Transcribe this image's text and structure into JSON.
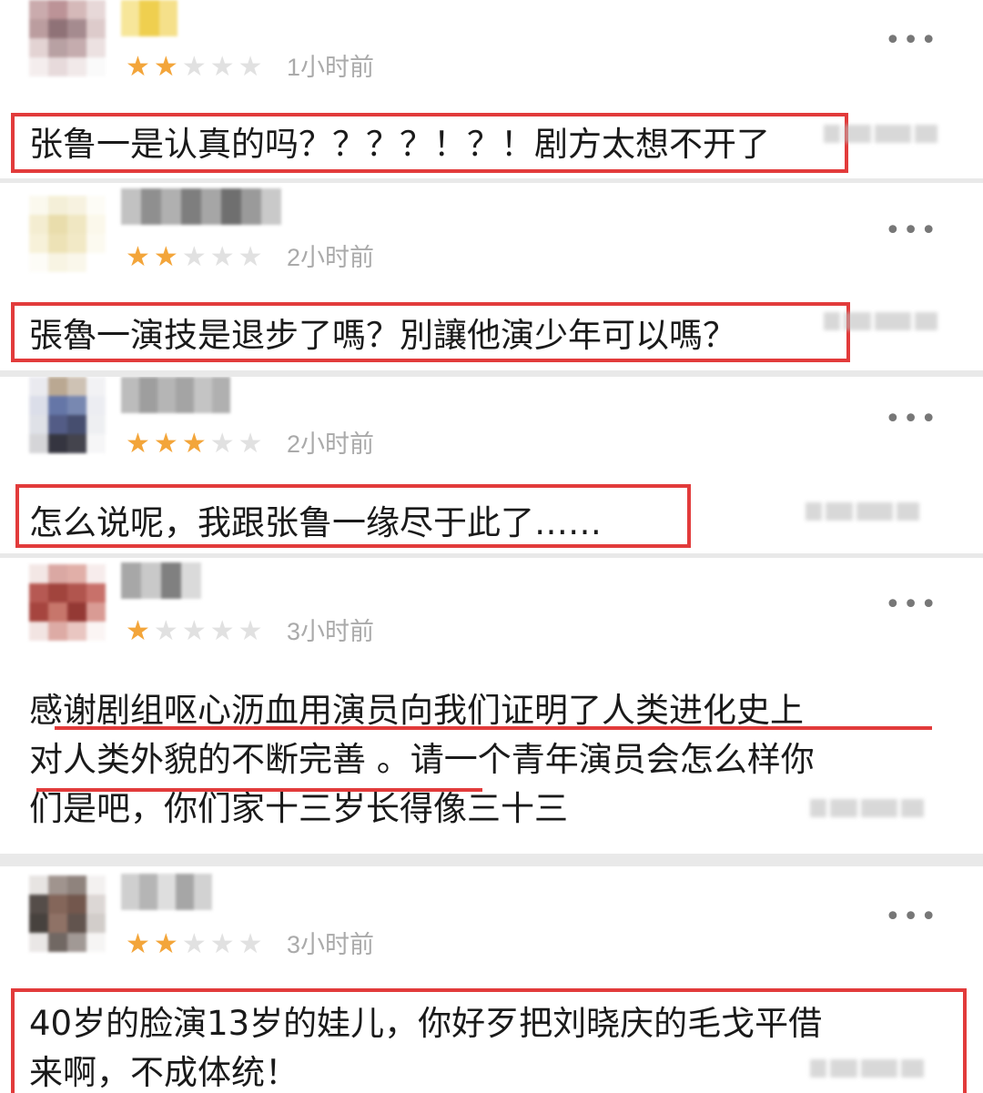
{
  "reviews": [
    {
      "stars_filled": 2,
      "stars_total": 5,
      "time": "1小时前",
      "text_lines": [
        "张鲁一是认真的吗？？？？！？！剧方太想不开了"
      ]
    },
    {
      "stars_filled": 2,
      "stars_total": 5,
      "time": "2小时前",
      "text_lines": [
        "張魯一演技是退步了嗎？別讓他演少年可以嗎？"
      ]
    },
    {
      "stars_filled": 3,
      "stars_total": 5,
      "time": "2小时前",
      "text_lines": [
        "怎么说呢，我跟张鲁一缘尽于此了……"
      ]
    },
    {
      "stars_filled": 1,
      "stars_total": 5,
      "time": "3小时前",
      "text_lines": [
        "感谢剧组呕心沥血用演员向我们证明了人类进化史上",
        "对人类外貌的不断完善 。请一个青年演员会怎么样你",
        "们是吧，你们家十三岁长得像三十三"
      ]
    },
    {
      "stars_filled": 2,
      "stars_total": 5,
      "time": "3小时前",
      "text_lines": [
        "40岁的脸演13岁的娃儿，你好歹把刘晓庆的毛戈平借",
        "来啊，不成体统！"
      ]
    }
  ],
  "more_label": "•••",
  "colors": {
    "highlight_red": "#e23b3b",
    "star_on": "#f3a53a",
    "star_off": "#e1e1e1",
    "time_gray": "#aaaaaa"
  },
  "icons": {
    "more": "more-dots-icon",
    "star": "star-icon"
  }
}
